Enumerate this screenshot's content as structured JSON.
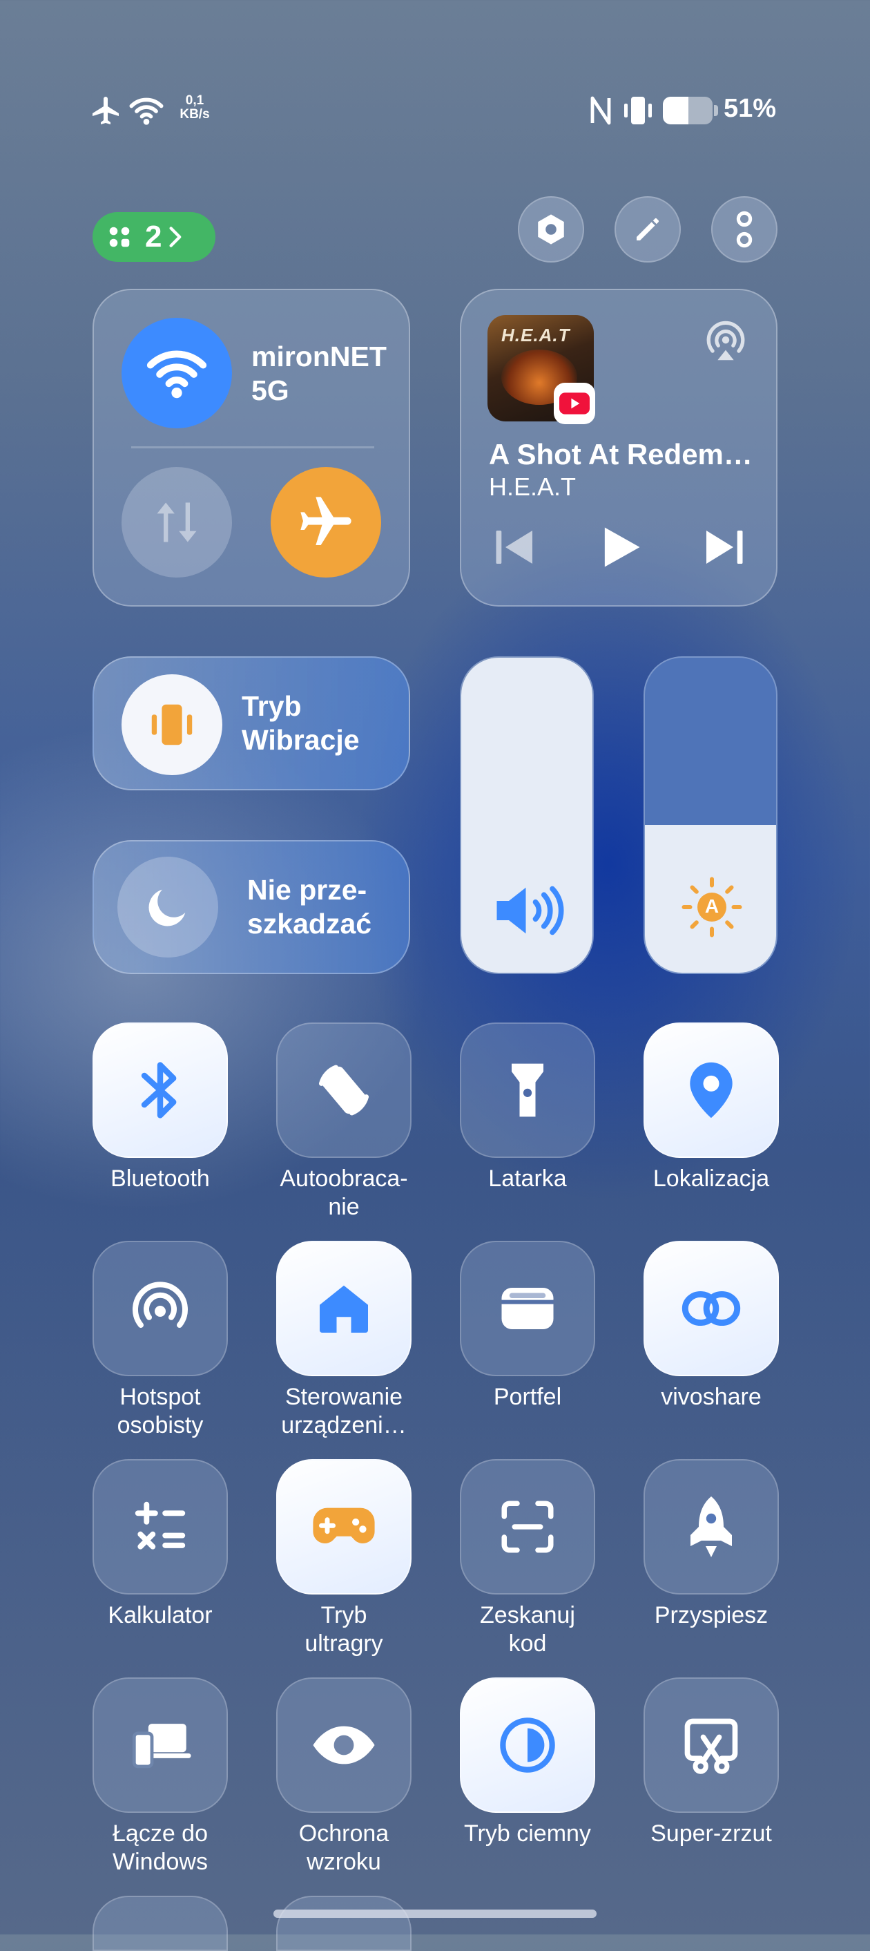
{
  "status_bar": {
    "net_speed_value": "0,1",
    "net_speed_unit": "KB/s",
    "battery_percent": "51%",
    "battery_level": 0.51,
    "icons": [
      "airplane-icon",
      "wifi-icon",
      "nfc-icon",
      "vibrate-icon",
      "battery-icon"
    ]
  },
  "header": {
    "pages_count": "2",
    "buttons": [
      "settings-icon",
      "edit-icon",
      "more-icon"
    ]
  },
  "network_card": {
    "wifi_name": "mironNET 5G",
    "wifi_on": true,
    "mobile_data_on": false,
    "airplane_on": true
  },
  "media_card": {
    "track_title": "A Shot At Redem…",
    "artist": "H.E.A.T",
    "app_badge": "youtube-icon",
    "cover_text": "H.E.A.T"
  },
  "mode_tiles": {
    "vibration_label": "Tryb Wibracje",
    "dnd_label": "Nie prze-szkadzać"
  },
  "sliders": {
    "volume_level": 1.0,
    "brightness_level": 0.47,
    "brightness_auto": "A"
  },
  "tiles": [
    {
      "label": "Bluetooth",
      "icon": "bluetooth-icon",
      "active": true
    },
    {
      "label": "Autoobraca-\nnie",
      "icon": "auto-rotate-icon",
      "active": false
    },
    {
      "label": "Latarka",
      "icon": "flashlight-icon",
      "active": false
    },
    {
      "label": "Lokalizacja",
      "icon": "location-icon",
      "active": true
    },
    {
      "label": "Hotspot\nosobisty",
      "icon": "hotspot-icon",
      "active": false
    },
    {
      "label": "Sterowanie\nurządzeni…",
      "icon": "home-icon",
      "active": true
    },
    {
      "label": "Portfel",
      "icon": "wallet-icon",
      "active": false
    },
    {
      "label": "vivoshare",
      "icon": "vivoshare-icon",
      "active": true
    },
    {
      "label": "Kalkulator",
      "icon": "calculator-icon",
      "active": false
    },
    {
      "label": "Tryb\nultragry",
      "icon": "gamepad-icon",
      "active": true
    },
    {
      "label": "Zeskanuj\nkod",
      "icon": "scan-icon",
      "active": false
    },
    {
      "label": "Przyspiesz",
      "icon": "rocket-icon",
      "active": false
    },
    {
      "label": "Łącze do\nWindows",
      "icon": "link-to-windows-icon",
      "active": false
    },
    {
      "label": "Ochrona\nwzroku",
      "icon": "eye-icon",
      "active": false
    },
    {
      "label": "Tryb ciemny",
      "icon": "dark-mode-icon",
      "active": true
    },
    {
      "label": "Super-zrzut",
      "icon": "screenshot-icon",
      "active": false
    }
  ],
  "colors": {
    "accent_blue": "#3d8bff",
    "accent_orange": "#f2a43a",
    "pill_green": "#43b665"
  }
}
